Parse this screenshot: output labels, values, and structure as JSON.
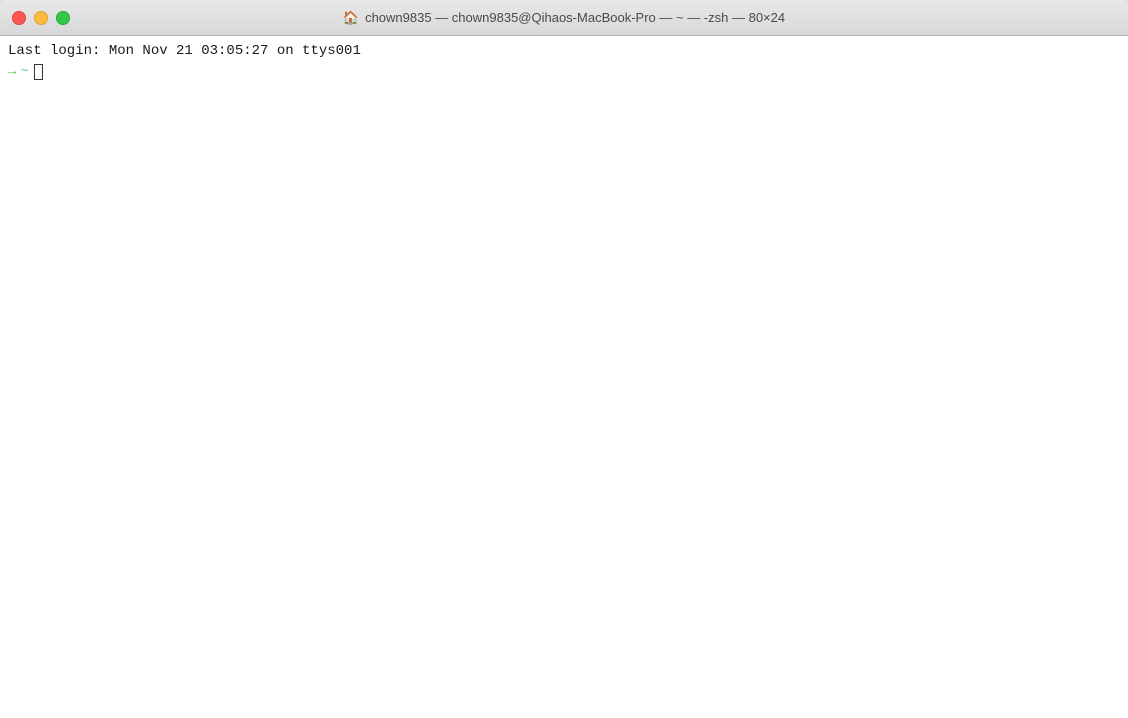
{
  "titleBar": {
    "title": "chown9835 — chown9835@Qihaos-MacBook-Pro — ~ — -zsh — 80×24",
    "homeIcon": "🏠"
  },
  "terminal": {
    "lastLoginLine": "Last login: Mon Nov 21 03:05:27 on ttys001",
    "promptArrow": "→",
    "promptTilde": "~"
  },
  "buttons": {
    "close": "close",
    "minimize": "minimize",
    "maximize": "maximize"
  }
}
